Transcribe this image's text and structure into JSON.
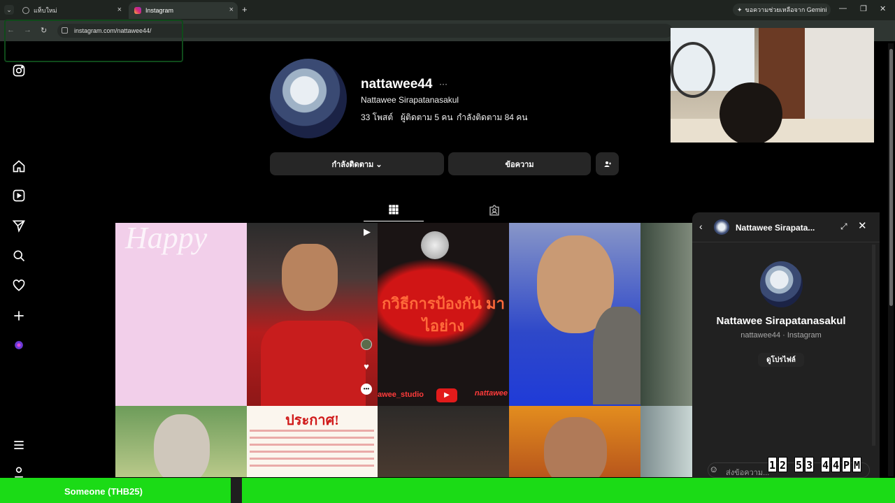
{
  "browser": {
    "tabs": [
      {
        "label": "แท็บใหม่"
      },
      {
        "label": "Instagram"
      }
    ],
    "url": "instagram.com/nattawee44/",
    "gemini_label": "ขอความช่วยเหลือจาก Gemini",
    "new_tab_symbol": "+",
    "close_symbol": "×"
  },
  "profile": {
    "username": "nattawee44",
    "more_symbol": "···",
    "full_name": "Nattawee Sirapatanasakul",
    "stats": {
      "posts": "33 โพสต์",
      "followers": "ผู้ติดตาม 5 คน",
      "following": "กำลังติดตาม 84 คน"
    },
    "buttons": {
      "following": "กำลังติดตาม ⌄",
      "message": "ข้อความ"
    }
  },
  "posts": {
    "p1_text": "Happy",
    "p3_text": "กวิธีการป้องกัน มาไอย่าง",
    "p3_footer_left": "awee_studio",
    "p3_footer_right": "nattawee",
    "p7_title": "ประกาศ!"
  },
  "chat": {
    "title": "Nattawee Sirapata...",
    "name": "Nattawee Sirapatanasakul",
    "subtitle": "nattawee44 · Instagram",
    "view_profile": "ดูโปรไฟล์",
    "placeholder": "ส่งข้อความ..."
  },
  "clock": {
    "digits": [
      "1",
      "2",
      "5",
      "3",
      "4",
      "4",
      "P",
      "M"
    ]
  },
  "donation": {
    "text": "Someone (THB25)"
  },
  "icons": {
    "sidebar": [
      "instagram-icon",
      "home-icon",
      "reels-icon",
      "send-icon",
      "search-icon",
      "heart-icon",
      "plus-icon",
      "meta-ai-icon",
      "menu-icon",
      "threads-icon"
    ]
  }
}
